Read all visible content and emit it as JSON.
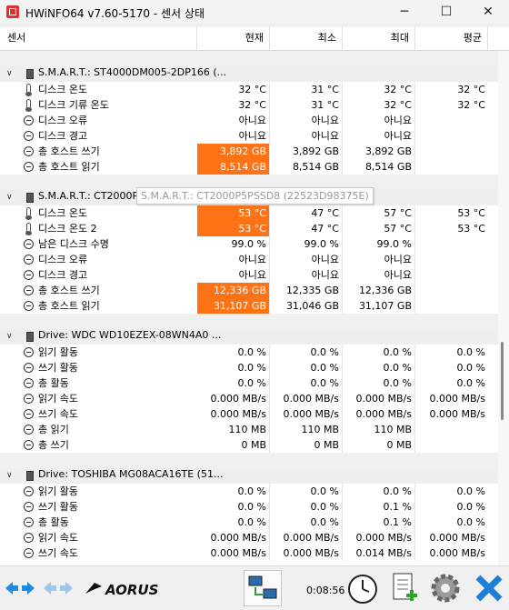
{
  "window": {
    "title": "HWiNFO64 v7.60-5170 - 센서 상태",
    "controls": {
      "minimize": "─",
      "maximize": "☐",
      "close": "✕"
    }
  },
  "columns": {
    "sensor": "센서",
    "current": "현재",
    "min": "최소",
    "max": "최대",
    "avg": "평균"
  },
  "groups": [
    {
      "title": "S.M.A.R.T.: ST4000DM005-2DP166 (...",
      "rows": [
        {
          "icon": "thermometer-icon",
          "label": "디스크 온도",
          "current": "32 °C",
          "min": "31 °C",
          "max": "32 °C",
          "avg": "32 °C",
          "highlight": false
        },
        {
          "icon": "thermometer-icon",
          "label": "디스크 기류 온도",
          "current": "32 °C",
          "min": "31 °C",
          "max": "32 °C",
          "avg": "32 °C",
          "highlight": false
        },
        {
          "icon": "clock-icon",
          "label": "디스크 오류",
          "current": "아니요",
          "min": "아니요",
          "max": "아니요",
          "avg": "",
          "highlight": false
        },
        {
          "icon": "clock-icon",
          "label": "디스크 경고",
          "current": "아니요",
          "min": "아니요",
          "max": "아니요",
          "avg": "",
          "highlight": false
        },
        {
          "icon": "clock-icon",
          "label": "총 호스트 쓰기",
          "current": "3,892 GB",
          "min": "3,892 GB",
          "max": "3,892 GB",
          "avg": "",
          "highlight": true
        },
        {
          "icon": "clock-icon",
          "label": "총 호스트 읽기",
          "current": "8,514 GB",
          "min": "8,514 GB",
          "max": "8,514 GB",
          "avg": "",
          "highlight": true
        }
      ]
    },
    {
      "title": "S.M.A.R.T.: CT2000P5PSSD8 (22523D98375E)",
      "rows": [
        {
          "icon": "thermometer-icon",
          "label": "디스크 온도",
          "current": "53 °C",
          "min": "47 °C",
          "max": "57 °C",
          "avg": "53 °C",
          "highlight": true
        },
        {
          "icon": "thermometer-icon",
          "label": "디스크 온도 2",
          "current": "53 °C",
          "min": "47 °C",
          "max": "57 °C",
          "avg": "53 °C",
          "highlight": true
        },
        {
          "icon": "clock-icon",
          "label": "남은 디스크 수명",
          "current": "99.0 %",
          "min": "99.0 %",
          "max": "99.0 %",
          "avg": "",
          "highlight": false
        },
        {
          "icon": "clock-icon",
          "label": "디스크 오류",
          "current": "아니요",
          "min": "아니요",
          "max": "아니요",
          "avg": "",
          "highlight": false
        },
        {
          "icon": "clock-icon",
          "label": "디스크 경고",
          "current": "아니요",
          "min": "아니요",
          "max": "아니요",
          "avg": "",
          "highlight": false
        },
        {
          "icon": "clock-icon",
          "label": "총 호스트 쓰기",
          "current": "12,336 GB",
          "min": "12,335 GB",
          "max": "12,336 GB",
          "avg": "",
          "highlight": true
        },
        {
          "icon": "clock-icon",
          "label": "총 호스트 읽기",
          "current": "31,107 GB",
          "min": "31,046 GB",
          "max": "31,107 GB",
          "avg": "",
          "highlight": true
        }
      ]
    },
    {
      "title": "Drive: WDC WD10EZEX-08WN4A0 ...",
      "rows": [
        {
          "icon": "clock-icon",
          "label": "읽기 활동",
          "current": "0.0 %",
          "min": "0.0 %",
          "max": "0.0 %",
          "avg": "0.0 %",
          "highlight": false
        },
        {
          "icon": "clock-icon",
          "label": "쓰기 활동",
          "current": "0.0 %",
          "min": "0.0 %",
          "max": "0.0 %",
          "avg": "0.0 %",
          "highlight": false
        },
        {
          "icon": "clock-icon",
          "label": "총 활동",
          "current": "0.0 %",
          "min": "0.0 %",
          "max": "0.0 %",
          "avg": "0.0 %",
          "highlight": false
        },
        {
          "icon": "clock-icon",
          "label": "읽기 속도",
          "current": "0.000 MB/s",
          "min": "0.000 MB/s",
          "max": "0.000 MB/s",
          "avg": "0.000 MB/s",
          "highlight": false
        },
        {
          "icon": "clock-icon",
          "label": "쓰기 속도",
          "current": "0.000 MB/s",
          "min": "0.000 MB/s",
          "max": "0.000 MB/s",
          "avg": "0.000 MB/s",
          "highlight": false
        },
        {
          "icon": "clock-icon",
          "label": "총 읽기",
          "current": "110 MB",
          "min": "110 MB",
          "max": "110 MB",
          "avg": "",
          "highlight": false
        },
        {
          "icon": "clock-icon",
          "label": "총 쓰기",
          "current": "0 MB",
          "min": "0 MB",
          "max": "0 MB",
          "avg": "",
          "highlight": false
        }
      ]
    },
    {
      "title": "Drive: TOSHIBA MG08ACA16TE (51...",
      "rows": [
        {
          "icon": "clock-icon",
          "label": "읽기 활동",
          "current": "0.0 %",
          "min": "0.0 %",
          "max": "0.0 %",
          "avg": "0.0 %",
          "highlight": false
        },
        {
          "icon": "clock-icon",
          "label": "쓰기 활동",
          "current": "0.0 %",
          "min": "0.0 %",
          "max": "0.1 %",
          "avg": "0.0 %",
          "highlight": false
        },
        {
          "icon": "clock-icon",
          "label": "총 활동",
          "current": "0.0 %",
          "min": "0.0 %",
          "max": "0.1 %",
          "avg": "0.0 %",
          "highlight": false
        },
        {
          "icon": "clock-icon",
          "label": "읽기 속도",
          "current": "0.000 MB/s",
          "min": "0.000 MB/s",
          "max": "0.000 MB/s",
          "avg": "0.000 MB/s",
          "highlight": false
        },
        {
          "icon": "clock-icon",
          "label": "쓰기 속도",
          "current": "0.000 MB/s",
          "min": "0.000 MB/s",
          "max": "0.014 MB/s",
          "avg": "0.000 MB/s",
          "highlight": false
        }
      ]
    }
  ],
  "tooltip": "S.M.A.R.T.: CT2000P5PSSD8 (22523D98375E)",
  "toolbar": {
    "elapsed_time": "0:08:56",
    "brand": "AORUS"
  },
  "colors": {
    "highlight": "#ff7316",
    "close_blue": "#1e7fd6"
  }
}
